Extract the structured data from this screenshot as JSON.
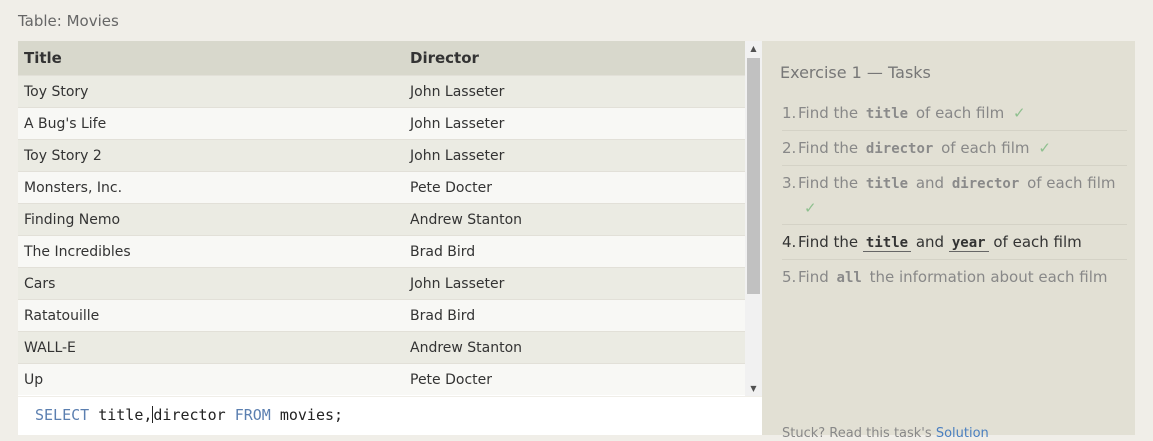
{
  "table_caption": "Table: Movies",
  "table": {
    "columns": [
      "Title",
      "Director"
    ],
    "rows": [
      [
        "Toy Story",
        "John Lasseter"
      ],
      [
        "A Bug's Life",
        "John Lasseter"
      ],
      [
        "Toy Story 2",
        "John Lasseter"
      ],
      [
        "Monsters, Inc.",
        "Pete Docter"
      ],
      [
        "Finding Nemo",
        "Andrew Stanton"
      ],
      [
        "The Incredibles",
        "Brad Bird"
      ],
      [
        "Cars",
        "John Lasseter"
      ],
      [
        "Ratatouille",
        "Brad Bird"
      ],
      [
        "WALL-E",
        "Andrew Stanton"
      ],
      [
        "Up",
        "Pete Docter"
      ]
    ]
  },
  "editor": {
    "kw_select": "SELECT",
    "cols_before_caret": " title,",
    "cols_after_caret": "director ",
    "kw_from": "FROM",
    "table_name": " movies;"
  },
  "panel": {
    "title": "Exercise 1 — Tasks",
    "tasks": [
      {
        "num": "1.",
        "a": "Find the",
        "b": "title",
        "c": "of each film",
        "check": "✓"
      },
      {
        "num": "2.",
        "a": "Find the",
        "b": "director",
        "c": "of each film",
        "check": "✓"
      },
      {
        "num": "3.",
        "a": "Find the",
        "b": "title",
        "c": "and",
        "d": "director",
        "e": "of each film",
        "check": "✓"
      },
      {
        "num": "4.",
        "a": "Find the",
        "b": "title",
        "c": "and",
        "d": "year",
        "e": "of each film"
      },
      {
        "num": "5.",
        "a": "Find",
        "b": "all",
        "c": "the information about each film"
      }
    ],
    "stuck_text": "Stuck? Read this task's",
    "solution_link": "Solution"
  },
  "colors": {
    "page_bg": "#f0eee8",
    "header_bg": "#d8d8cc",
    "panel_bg": "#e2e0d4",
    "keyword": "#5b7fb0",
    "check": "#8fc08f",
    "link": "#4a7fc0"
  }
}
